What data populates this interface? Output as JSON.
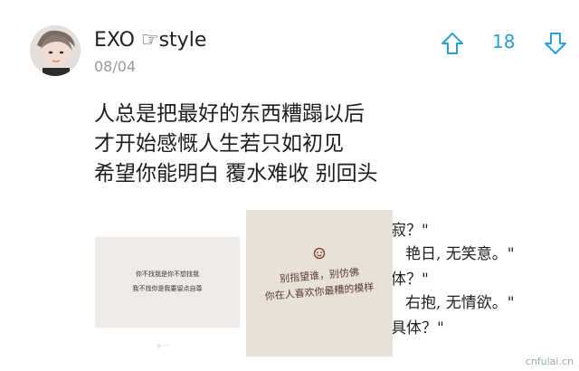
{
  "post": {
    "username": "EXO ☞style",
    "date": "08/04",
    "vote_count": "18",
    "lines": [
      "人总是把最好的东西糟蹋以后",
      "才开始感慨人生若只如初见",
      "希望你能明白 覆水难收 别回头"
    ]
  },
  "images": {
    "img1": {
      "line1": "你不找我是你不想找我",
      "line2": "我不找你是我要留点自尊"
    },
    "img2": {
      "line1": "别指望谁，别仿佛",
      "line2": "你在人喜欢你最糟的模样"
    },
    "img3": {
      "lines": [
        "寂？\"",
        "艳日, 无笑意。\"",
        "体？\"",
        "右抱, 无情欲。\"",
        "具体？\""
      ]
    }
  },
  "watermark": {
    "text": "cnfulai.cn"
  },
  "colors": {
    "accent": "#2a9fd6",
    "text": "#1e1e1e",
    "muted": "#999999"
  }
}
